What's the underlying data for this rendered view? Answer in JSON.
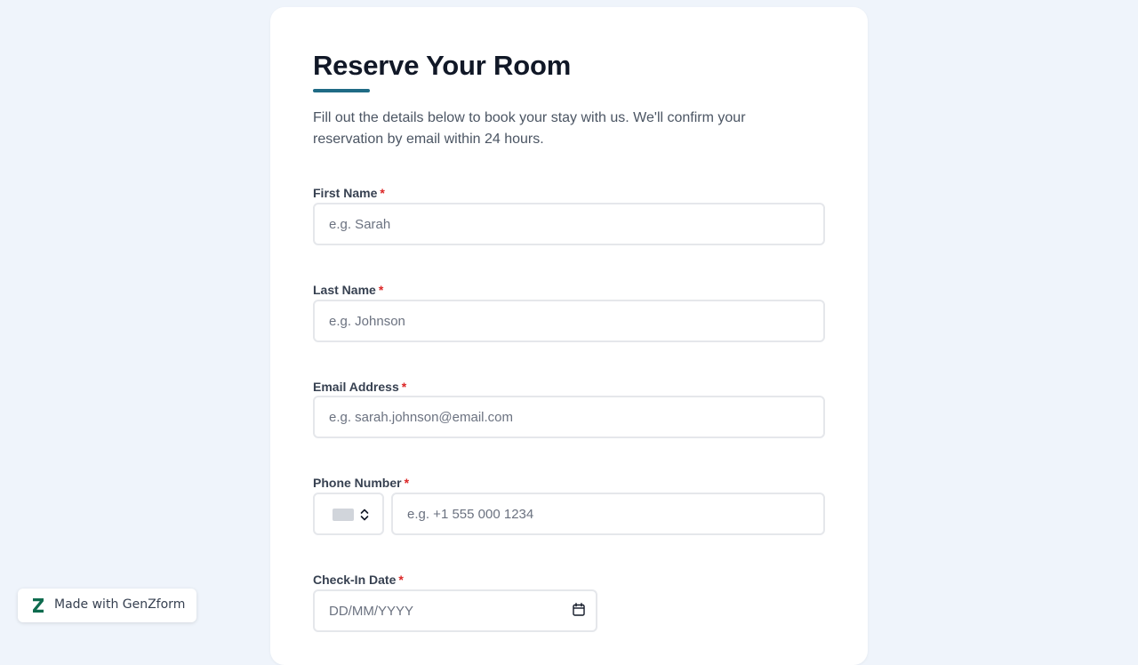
{
  "form": {
    "title": "Reserve Your Room",
    "intro": "Fill out the details below to book your stay with us. We'll confirm your reservation by email within 24 hours.",
    "required_marker": "*",
    "accent_color": "#1f6b85",
    "fields": {
      "first_name": {
        "label": "First Name",
        "placeholder": "e.g. Sarah",
        "value": ""
      },
      "last_name": {
        "label": "Last Name",
        "placeholder": "e.g. Johnson",
        "value": ""
      },
      "email": {
        "label": "Email Address",
        "placeholder": "e.g. sarah.johnson@email.com",
        "value": ""
      },
      "phone": {
        "label": "Phone Number",
        "placeholder": "e.g. +1 555 000 1234",
        "value": ""
      },
      "check_in": {
        "label": "Check-In Date",
        "placeholder": "DD/MM/YYYY"
      }
    }
  },
  "icons": {
    "country_select": "chevron-up-down-icon",
    "date_picker": "calendar-icon",
    "brand": "genzform-logo-icon"
  },
  "badge": {
    "text": "Made with GenZform",
    "logo_color": "#0e6b4e"
  }
}
